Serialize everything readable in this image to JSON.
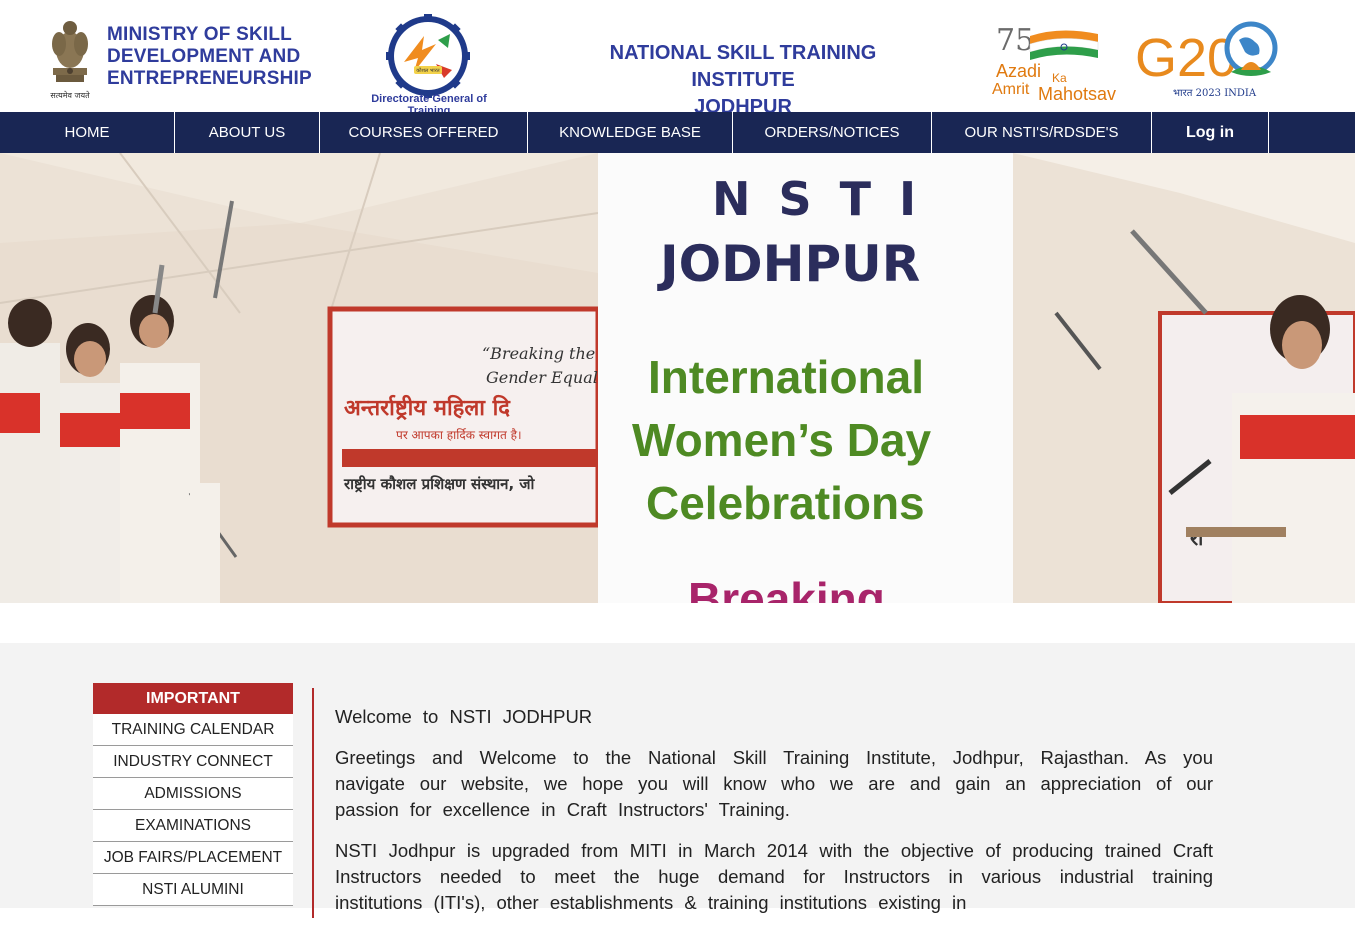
{
  "header": {
    "ministry_line1": "MINISTRY OF SKILL",
    "ministry_line2": "DEVELOPMENT AND",
    "ministry_line3": "ENTREPRENEURSHIP",
    "emblem_motto": "सत्यमेव जयते",
    "dgt_caption": "Directorate General of Training",
    "dgt_inner": "कौशल भारत",
    "institute_line1": "NATIONAL SKILL TRAINING INSTITUTE",
    "institute_line2": "JODHPUR",
    "azadi_75": "75",
    "azadi_line1": "Azadi",
    "azadi_ka": "Ka",
    "azadi_line2": "Amrit",
    "azadi_line3": "Mahotsav",
    "g20_text": "G20",
    "g20_caption": "भारत 2023 INDIA"
  },
  "nav": {
    "items": [
      {
        "label": "HOME"
      },
      {
        "label": "ABOUT US"
      },
      {
        "label": "COURSES OFFERED"
      },
      {
        "label": "KNOWLEDGE BASE"
      },
      {
        "label": "ORDERS/NOTICES"
      },
      {
        "label": "OUR NSTI'S/RDSDE'S"
      },
      {
        "label": "Log in"
      }
    ]
  },
  "banner": {
    "line1": "N S T I",
    "line2": "JODHPUR",
    "line3": "International",
    "line4": "Women’s Day",
    "line5": "Celebrations",
    "line6": "Breaking",
    "sign_quote1": "“Breaking the",
    "sign_quote2": "Gender Equal",
    "sign_hindi1": "अन्तर्राष्ट्रीय महिला दि",
    "sign_hindi2": "पर आपका हार्दिक स्वागत है।",
    "sign_hindi3": "राष्ट्रीय कौशल प्रशिक्षण संस्थान, जो",
    "sign_right": "रा",
    "colors": {
      "title_blue": "#2b2d5c",
      "title_green": "#4e8a23",
      "sign_red": "#c0392b"
    }
  },
  "sidebar": {
    "heading": "IMPORTANT",
    "items": [
      {
        "label": "TRAINING CALENDAR"
      },
      {
        "label": "INDUSTRY CONNECT"
      },
      {
        "label": "ADMISSIONS"
      },
      {
        "label": "EXAMINATIONS"
      },
      {
        "label": "JOB FAIRS/PLACEMENT"
      },
      {
        "label": "NSTI ALUMINI"
      }
    ]
  },
  "main": {
    "welcome": "Welcome to NSTI JODHPUR",
    "para1": "Greetings and Welcome to the National Skill Training Institute, Jodhpur, Rajasthan. As you navigate our website, we hope you will know who we are and gain an appreciation of our passion for excellence in Craft Instructors' Training.",
    "para2": "NSTI Jodhpur is upgraded from MITI in March 2014 with the objective of producing trained Craft Instructors needed to meet the huge demand for Instructors in various industrial training institutions (ITI's), other establishments & training institutions existing in"
  },
  "colors": {
    "nav_bg": "#192654",
    "brand_blue": "#2f3c9c",
    "accent_red": "#b22a2a",
    "content_bg": "#f3f3f3"
  }
}
